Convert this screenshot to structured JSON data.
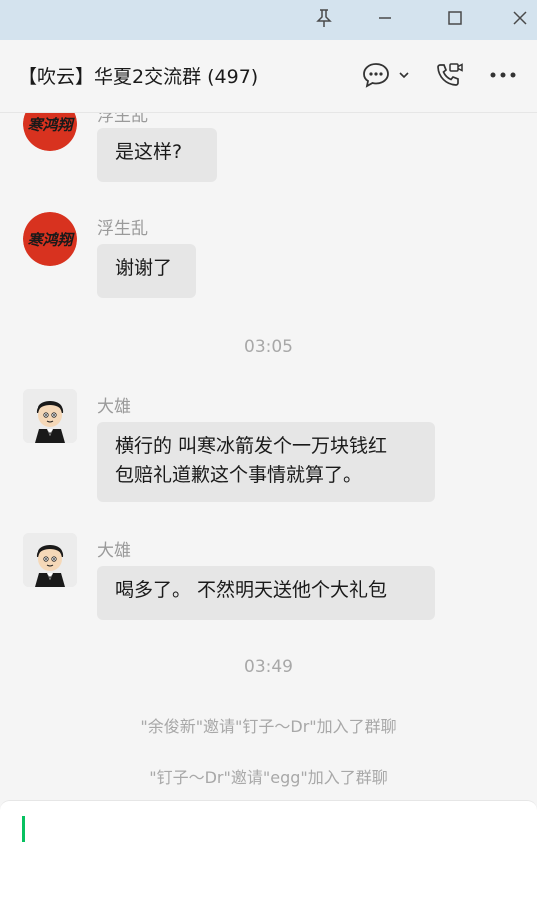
{
  "window": {
    "pin_icon": "pin-icon",
    "minimize_icon": "minimize-icon",
    "maximize_icon": "maximize-icon",
    "close_icon": "close-icon"
  },
  "header": {
    "title": "【吹云】华夏2交流群 (497)",
    "chat_icon": "chat-bubble-icon",
    "dropdown_icon": "chevron-down-icon",
    "call_icon": "video-call-icon",
    "more_icon": "more-icon"
  },
  "messages": [
    {
      "sender": "浮生乱",
      "text": "是这样?"
    },
    {
      "sender": "浮生乱",
      "text": "谢谢了"
    },
    {
      "type": "time",
      "text": "03:05"
    },
    {
      "sender": "大雄",
      "text_line1": "横行的 叫寒冰箭发个一万块钱红",
      "text_line2": "包赔礼道歉这个事情就算了。"
    },
    {
      "sender": "大雄",
      "text": "喝多了。 不然明天送他个大礼包"
    },
    {
      "type": "time",
      "text": "03:49"
    },
    {
      "type": "system",
      "text": "\"余俊新\"邀请\"钉子～Dr\"加入了群聊"
    },
    {
      "type": "system",
      "text": "\"钉子～Dr\"邀请\"egg\"加入了群聊"
    }
  ],
  "avatar_seal_text": "寒鸿翔",
  "colors": {
    "titlebar": "#d4e3ee",
    "bubble": "#e6e6e6",
    "caret": "#07c160",
    "seal_red": "#d8321f"
  },
  "input": {
    "value": ""
  }
}
